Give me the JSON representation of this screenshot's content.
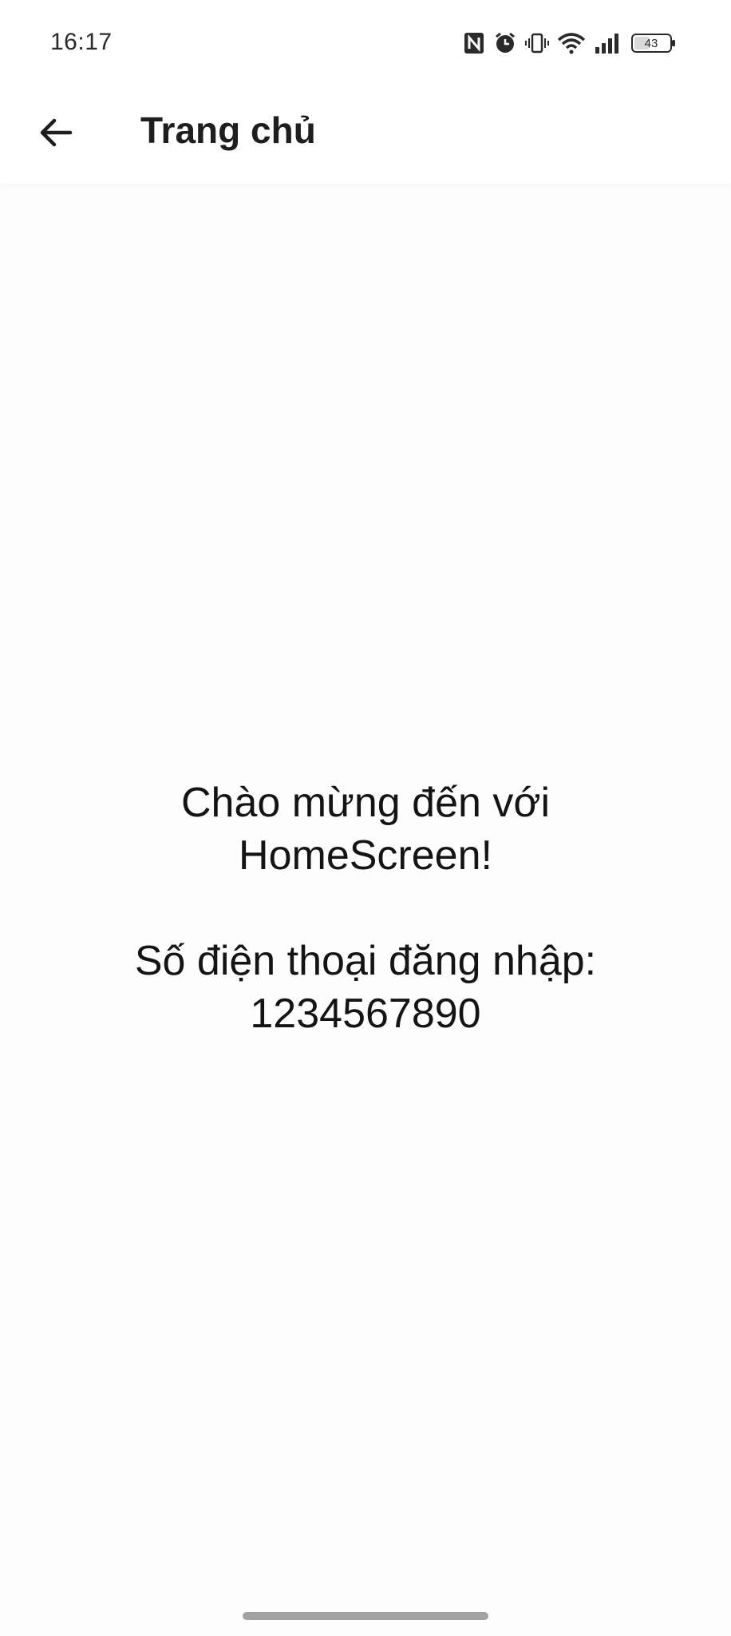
{
  "status_bar": {
    "time": "16:17",
    "icons": [
      "nfc-icon",
      "alarm-icon",
      "vibrate-icon",
      "wifi-icon",
      "signal-icon",
      "battery-icon"
    ],
    "battery_level": "43"
  },
  "app_bar": {
    "back_icon": "arrow-left-icon",
    "title": "Trang chủ"
  },
  "main": {
    "welcome_line1": "Chào mừng đến với",
    "welcome_line2": "HomeScreen!",
    "phone_label": "Số điện thoại đăng nhập:",
    "phone_number": "1234567890"
  },
  "colors": {
    "background": "#fdfdfd",
    "text": "#141414",
    "gesture_bar": "#a2a2a2"
  }
}
